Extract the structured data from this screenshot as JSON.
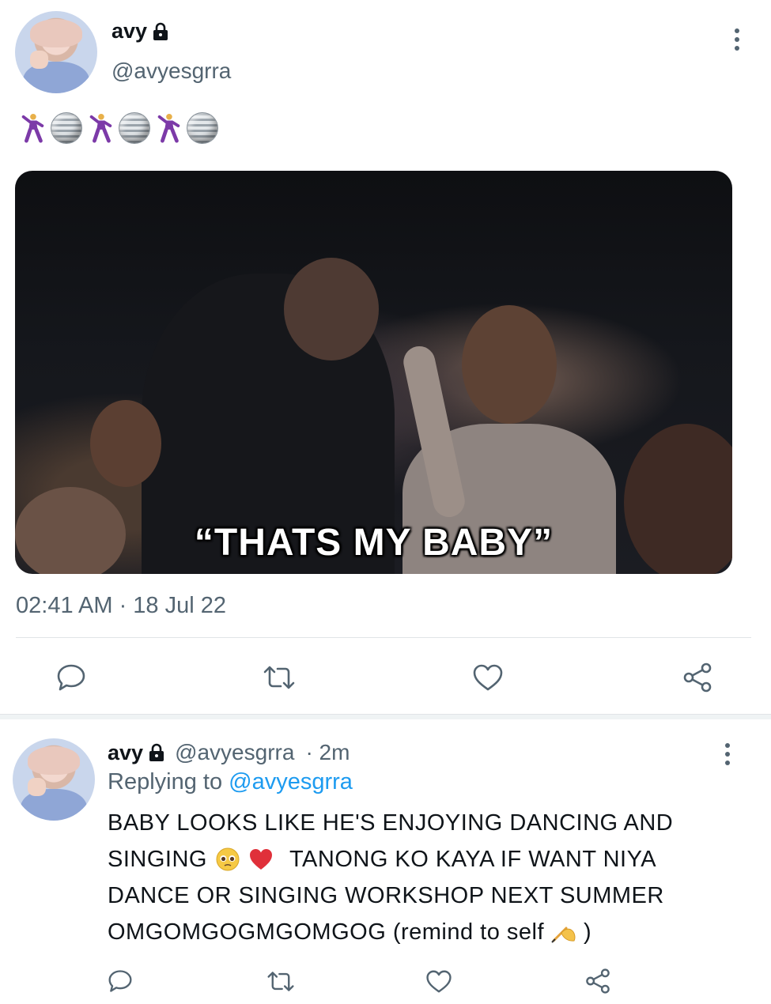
{
  "main_tweet": {
    "author_name": "avy",
    "author_handle": "@avyesgrra",
    "emoji_line": [
      "dancer",
      "disco-ball",
      "dancer",
      "disco-ball",
      "dancer",
      "disco-ball"
    ],
    "media_caption": "“THATS MY BABY”",
    "timestamp": "02:41 AM · 18 Jul 22"
  },
  "reply_tweet": {
    "author_name": "avy",
    "author_handle": "@avyesgrra",
    "time_ago": "· 2m",
    "replying_prefix": "Replying to",
    "replying_handle": "@avyesgrra",
    "text_line1": "BABY LOOKS LIKE HE'S ENJOYING DANCING AND",
    "text_line2a": "SINGING",
    "text_line2b": "TANONG KO KAYA IF WANT NIYA",
    "text_line3": "DANCE OR SINGING WORKSHOP NEXT SUMMER",
    "text_line4a": "OMGOMGOGMGOMGOG (remind to self",
    "text_line4b": ")"
  },
  "icons": {
    "lock": "lock-icon",
    "more": "more-icon",
    "reply": "reply-icon",
    "retweet": "retweet-icon",
    "like": "heart-icon",
    "share": "share-icon"
  },
  "colors": {
    "link": "#1d9bf0",
    "secondary_text": "#536471",
    "icon": "#536471"
  }
}
